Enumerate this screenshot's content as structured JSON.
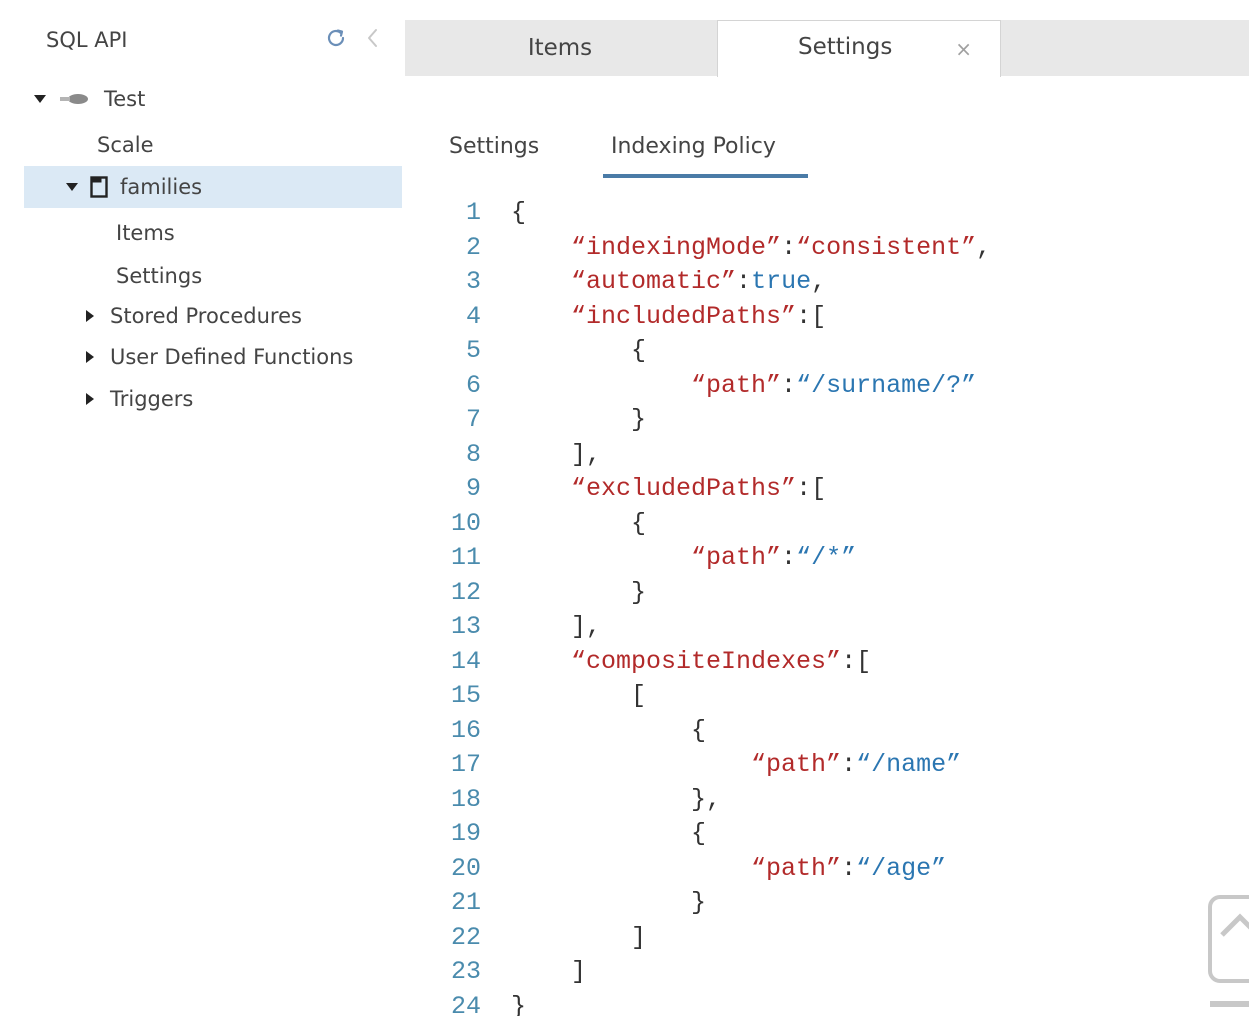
{
  "sidebar": {
    "api_title": "SQL API",
    "refresh_icon": "refresh-icon",
    "collapse_icon": "chevron-left-icon",
    "database": {
      "label": "Test",
      "icon": "database-icon"
    },
    "scale_label": "Scale",
    "collection": {
      "label": "families",
      "icon": "collection-icon"
    },
    "collection_children": {
      "items_label": "Items",
      "settings_label": "Settings"
    },
    "groups": [
      {
        "label": "Stored Procedures"
      },
      {
        "label": "User Defined Functions"
      },
      {
        "label": "Triggers"
      }
    ]
  },
  "tabs": [
    {
      "label": "Items",
      "active": false
    },
    {
      "label": "Settings",
      "active": true,
      "close_label": "×"
    }
  ],
  "subtabs": [
    {
      "label": "Settings",
      "active": false
    },
    {
      "label": "Indexing Policy",
      "active": true
    }
  ],
  "colors": {
    "accent_underline": "#4a7ba7",
    "selected_row": "#dbe9f5",
    "json_key": "#b22a2a",
    "json_value": "#2b76b1",
    "line_number": "#4a8bad"
  },
  "editor": {
    "lines": [
      {
        "no": "1",
        "indent": "",
        "tokens": [
          {
            "t": "{",
            "c": "punc"
          }
        ]
      },
      {
        "no": "2",
        "indent": "    ",
        "tokens": [
          {
            "t": "“indexingMode”",
            "c": "key"
          },
          {
            "t": ":",
            "c": "punc"
          },
          {
            "t": "“consistent”",
            "c": "key"
          },
          {
            "t": ",",
            "c": "punc"
          }
        ]
      },
      {
        "no": "3",
        "indent": "    ",
        "tokens": [
          {
            "t": "“automatic”",
            "c": "key"
          },
          {
            "t": ":",
            "c": "punc"
          },
          {
            "t": "true",
            "c": "lit"
          },
          {
            "t": ",",
            "c": "punc"
          }
        ]
      },
      {
        "no": "4",
        "indent": "    ",
        "tokens": [
          {
            "t": "“includedPaths”",
            "c": "key"
          },
          {
            "t": ":[",
            "c": "punc"
          }
        ]
      },
      {
        "no": "5",
        "indent": "        ",
        "tokens": [
          {
            "t": "{",
            "c": "punc"
          }
        ]
      },
      {
        "no": "6",
        "indent": "            ",
        "tokens": [
          {
            "t": "“path”",
            "c": "key"
          },
          {
            "t": ":",
            "c": "punc"
          },
          {
            "t": "“/surname/?”",
            "c": "str"
          }
        ]
      },
      {
        "no": "7",
        "indent": "        ",
        "tokens": [
          {
            "t": "}",
            "c": "punc"
          }
        ]
      },
      {
        "no": "8",
        "indent": "    ",
        "tokens": [
          {
            "t": "],",
            "c": "punc"
          }
        ]
      },
      {
        "no": "9",
        "indent": "    ",
        "tokens": [
          {
            "t": "“excludedPaths”",
            "c": "key"
          },
          {
            "t": ":[",
            "c": "punc"
          }
        ]
      },
      {
        "no": "10",
        "indent": "        ",
        "tokens": [
          {
            "t": "{",
            "c": "punc"
          }
        ]
      },
      {
        "no": "11",
        "indent": "            ",
        "tokens": [
          {
            "t": "“path”",
            "c": "key"
          },
          {
            "t": ":",
            "c": "punc"
          },
          {
            "t": "“/*”",
            "c": "str"
          }
        ]
      },
      {
        "no": "12",
        "indent": "        ",
        "tokens": [
          {
            "t": "}",
            "c": "punc"
          }
        ]
      },
      {
        "no": "13",
        "indent": "    ",
        "tokens": [
          {
            "t": "],",
            "c": "punc"
          }
        ]
      },
      {
        "no": "14",
        "indent": "    ",
        "tokens": [
          {
            "t": "“compositeIndexes”",
            "c": "key"
          },
          {
            "t": ":[",
            "c": "punc"
          }
        ]
      },
      {
        "no": "15",
        "indent": "        ",
        "tokens": [
          {
            "t": "[",
            "c": "punc"
          }
        ]
      },
      {
        "no": "16",
        "indent": "            ",
        "tokens": [
          {
            "t": "{",
            "c": "punc"
          }
        ]
      },
      {
        "no": "17",
        "indent": "                ",
        "tokens": [
          {
            "t": "“path”",
            "c": "key"
          },
          {
            "t": ":",
            "c": "punc"
          },
          {
            "t": "“/name”",
            "c": "str"
          }
        ]
      },
      {
        "no": "18",
        "indent": "            ",
        "tokens": [
          {
            "t": "},",
            "c": "punc"
          }
        ]
      },
      {
        "no": "19",
        "indent": "            ",
        "tokens": [
          {
            "t": "{",
            "c": "punc"
          }
        ]
      },
      {
        "no": "20",
        "indent": "                ",
        "tokens": [
          {
            "t": "“path”",
            "c": "key"
          },
          {
            "t": ":",
            "c": "punc"
          },
          {
            "t": "“/age”",
            "c": "str"
          }
        ]
      },
      {
        "no": "21",
        "indent": "            ",
        "tokens": [
          {
            "t": "}",
            "c": "punc"
          }
        ]
      },
      {
        "no": "22",
        "indent": "        ",
        "tokens": [
          {
            "t": "]",
            "c": "punc"
          }
        ]
      },
      {
        "no": "23",
        "indent": "    ",
        "tokens": [
          {
            "t": "]",
            "c": "punc"
          }
        ]
      },
      {
        "no": "24",
        "indent": "",
        "tokens": [
          {
            "t": "}",
            "c": "punc"
          }
        ]
      }
    ]
  }
}
